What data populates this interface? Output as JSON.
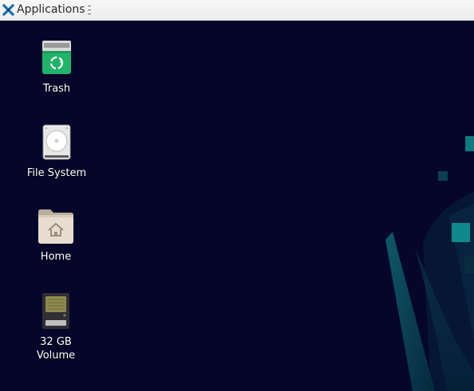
{
  "panel": {
    "applications_label": "Applications"
  },
  "desktop": {
    "icons": [
      {
        "label": "Trash",
        "icon": "trash-icon"
      },
      {
        "label": "File System",
        "icon": "hard-drive-icon"
      },
      {
        "label": "Home",
        "icon": "home-folder-icon"
      },
      {
        "label": "32 GB\nVolume",
        "icon": "memory-card-icon"
      }
    ]
  },
  "colors": {
    "panel_background": "#f0f0f0",
    "desktop_background": "#05062a",
    "wallpaper_accent": "#0e6b73",
    "trash_green": "#22b36b"
  }
}
